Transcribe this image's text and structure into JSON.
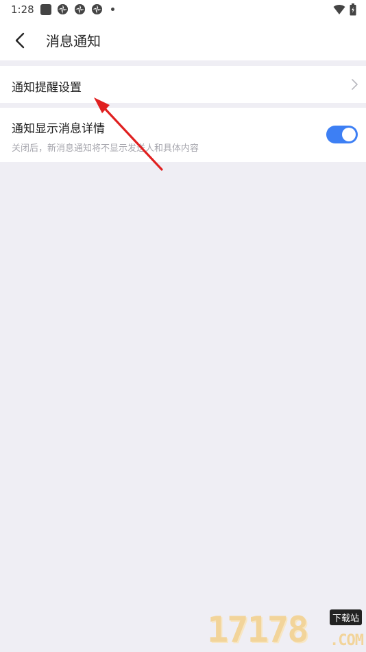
{
  "status_bar": {
    "time": "1:28",
    "left_icons": [
      "square-notification-icon",
      "wheel-notification-icon",
      "wheel-notification-icon",
      "wheel-notification-icon",
      "dot-icon"
    ],
    "right_icons": [
      "wifi-icon",
      "battery-icon"
    ]
  },
  "header": {
    "back_icon": "chevron-left-icon",
    "title": "消息通知"
  },
  "settings": {
    "reminder_row": {
      "label": "通知提醒设置",
      "icon": "chevron-right-icon"
    },
    "detail_row": {
      "label": "通知显示消息详情",
      "description": "关闭后，新消息通知将不显示发送人和具体内容",
      "toggle_on": true
    }
  },
  "colors": {
    "background": "#efeef4",
    "accent": "#3d7ff4",
    "annotation_arrow": "#e02020",
    "watermark": "#f2d49a"
  },
  "watermark": {
    "digits": "17178",
    "badge": "下载站",
    "suffix": ".COM"
  }
}
